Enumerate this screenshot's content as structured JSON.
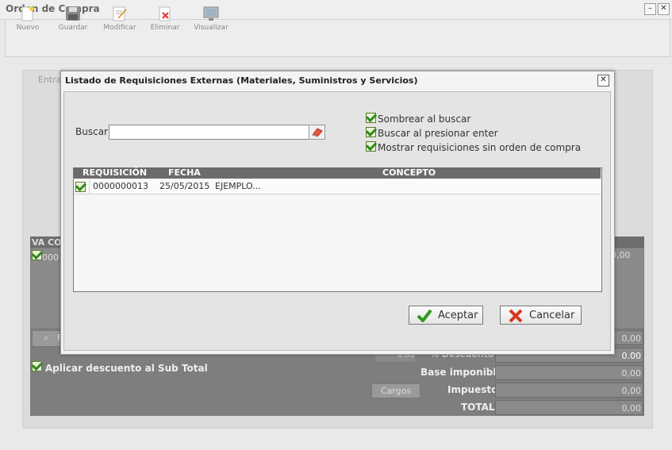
{
  "window": {
    "title": "Orden de Compra",
    "minimize": "–",
    "close": "✕"
  },
  "toolbar": [
    {
      "label": "Nuevo",
      "icon": "new-document-icon"
    },
    {
      "label": "Guardar",
      "icon": "save-disk-icon"
    },
    {
      "label": "Modificar",
      "icon": "edit-icon"
    },
    {
      "label": "Eliminar",
      "icon": "delete-icon"
    },
    {
      "label": "Visualizar",
      "icon": "monitor-icon"
    }
  ],
  "panel": {
    "tab": "Entra"
  },
  "background_table": {
    "header": "VA  CO",
    "row_value": "000",
    "right_value": "0,00",
    "search_btn": "F",
    "discount_input": "0.00",
    "discount_label": "% Descuento",
    "apply_discount": "Aplicar descuento al Sub Total",
    "totals": [
      {
        "label": "",
        "value": "0,00"
      },
      {
        "label": "",
        "value": "0.00"
      },
      {
        "label": "Base imponible",
        "value": "0,00"
      },
      {
        "label": "Impuesto",
        "value": "0,00"
      },
      {
        "label": "TOTAL",
        "value": "0,00"
      }
    ],
    "cargos_label": "Cargos"
  },
  "dialog": {
    "title": "Listado de Requisiciones Externas (Materiales, Suministros y Servicios)",
    "search_label": "Buscar",
    "search_value": "",
    "options": [
      {
        "label": "Sombrear al buscar",
        "checked": true
      },
      {
        "label": "Buscar al presionar enter",
        "checked": true
      },
      {
        "label": "Mostrar requisiciones sin orden de compra",
        "checked": true
      }
    ],
    "columns": [
      "REQUISICIÓN",
      "FECHA",
      "CONCEPTO"
    ],
    "rows": [
      {
        "checked": true,
        "requisicion": "0000000013",
        "fecha": "25/05/2015",
        "concepto": "EJEMPLO..."
      }
    ],
    "accept_label": "Aceptar",
    "cancel_label": "Cancelar"
  },
  "colors": {
    "accent_check": "#2f8a17",
    "dim_overlay": "#7e7e7e",
    "grid_header": "#6b6b6b"
  }
}
